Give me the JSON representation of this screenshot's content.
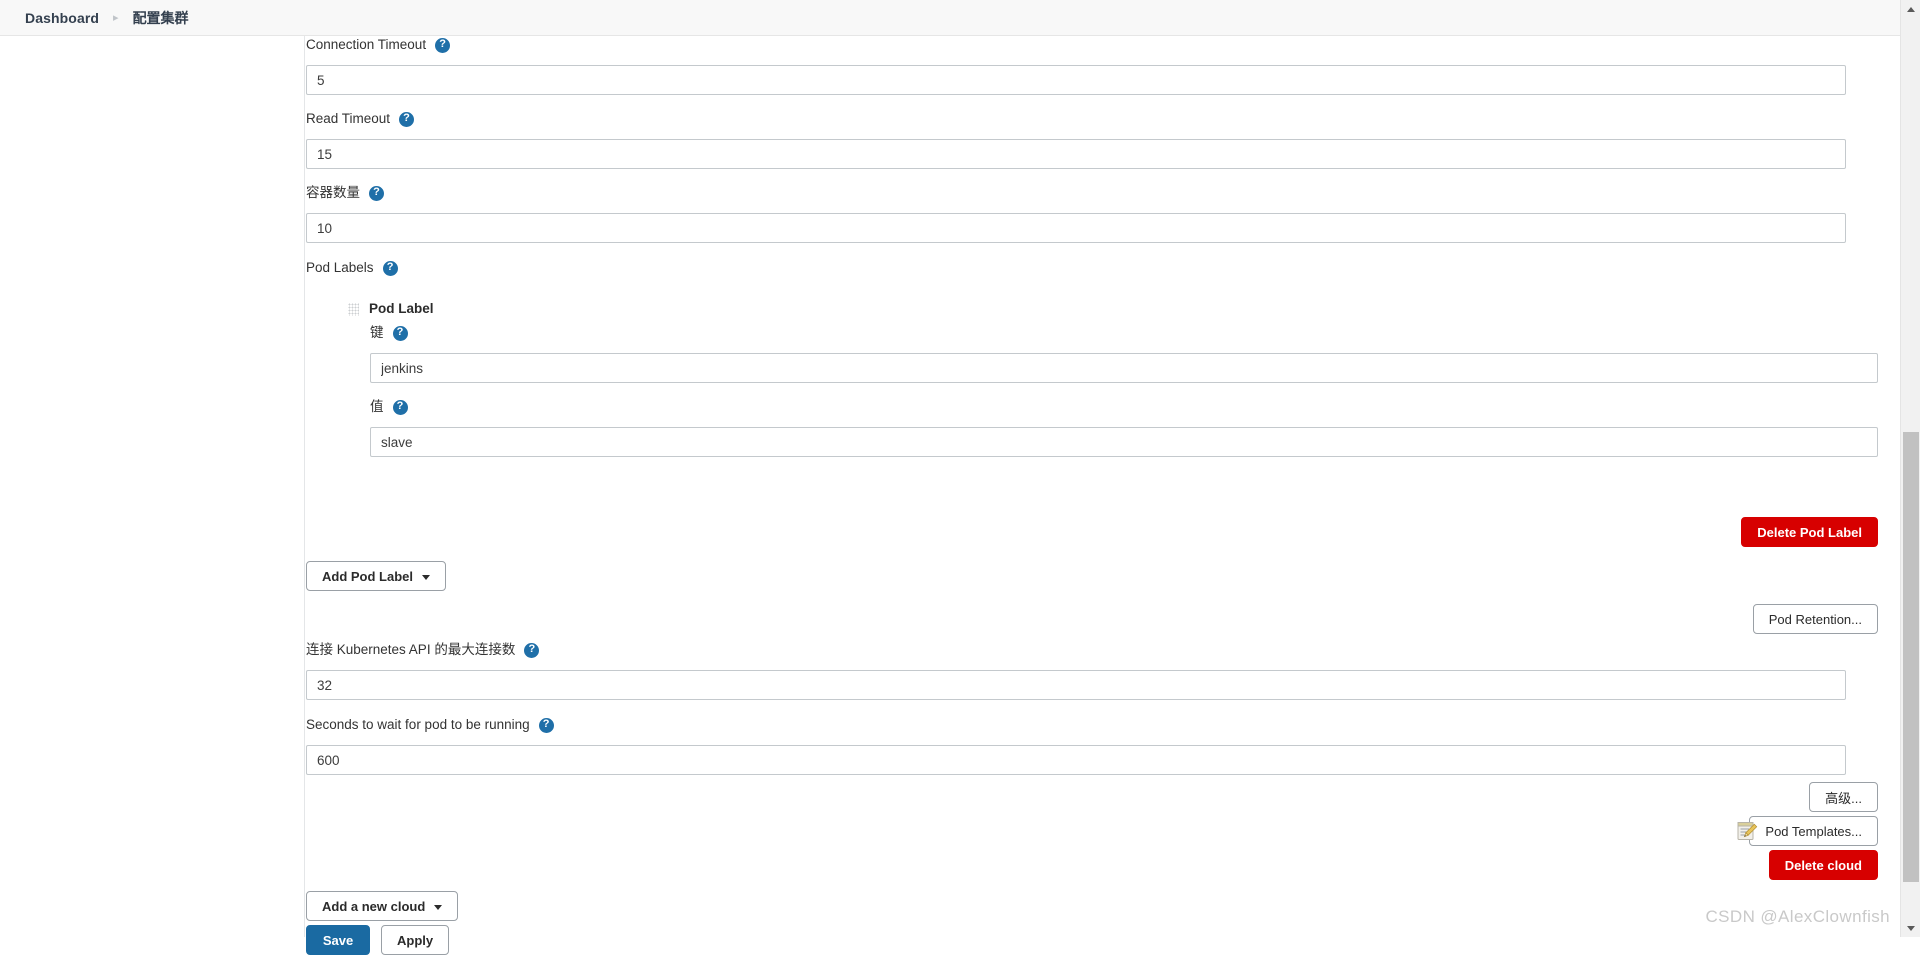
{
  "breadcrumb": {
    "items": [
      {
        "label": "Dashboard",
        "link": true
      },
      {
        "label": "配置集群",
        "link": false
      }
    ],
    "separator": "▸"
  },
  "help_icon_glyph": "?",
  "icons": {
    "help": "question-mark-circle-icon",
    "grip": "drag-handle-icon",
    "notepad": "notepad-pencil-icon",
    "caret": "caret-down-icon"
  },
  "colors": {
    "primary": "#1a6aa2",
    "danger": "#d70000",
    "help_badge": "#1f6fa8",
    "header_bg": "#f8f8f8",
    "text": "#333333"
  },
  "form": {
    "fields": [
      {
        "label": "Connection Timeout",
        "value": "5",
        "placeholder": ""
      },
      {
        "label": "Read Timeout",
        "value": "15",
        "placeholder": ""
      },
      {
        "label": "容器数量",
        "value": "10",
        "placeholder": ""
      }
    ],
    "pod_labels": {
      "section_label": "Pod Labels",
      "entry_title": "Pod Label",
      "key_label": "键",
      "key_value": "jenkins",
      "value_label": "值",
      "value_value": "slave",
      "delete_button": "Delete Pod Label",
      "add_button": "Add Pod Label"
    },
    "pod_retention_button": "Pod Retention...",
    "max_connections": {
      "label": "连接 Kubernetes API 的最大连接数",
      "value": "32"
    },
    "wait_seconds": {
      "label": "Seconds to wait for pod to be running",
      "value": "600"
    },
    "advanced_button": "高级...",
    "pod_templates_button": "Pod Templates...",
    "delete_cloud_button": "Delete cloud",
    "add_cloud_button": "Add a new cloud"
  },
  "footer": {
    "save_button": "Save",
    "apply_button": "Apply"
  },
  "watermark": "CSDN @AlexClownfish"
}
